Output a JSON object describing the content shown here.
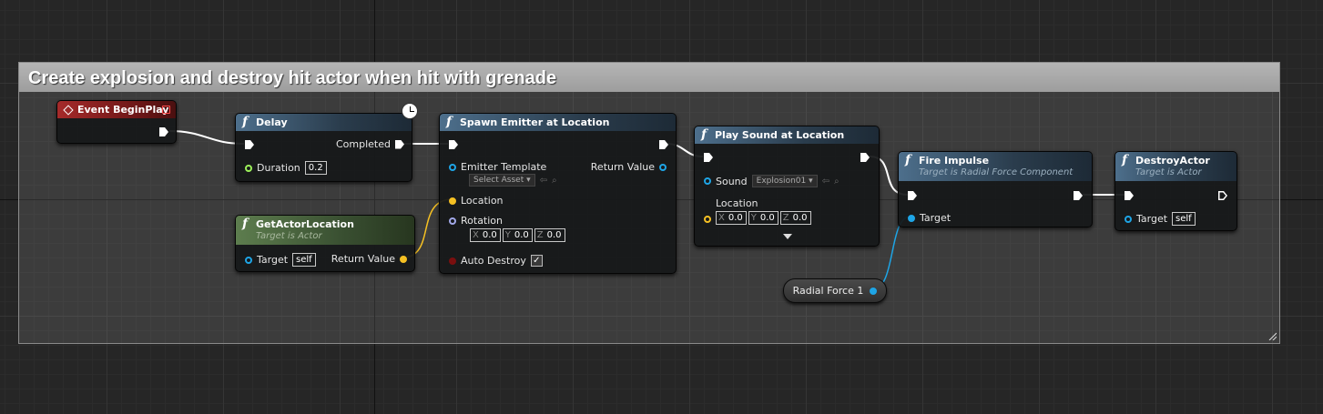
{
  "comment": {
    "title": "Create explosion and destroy hit actor when hit with grenade"
  },
  "nodes": {
    "event_begin_play": {
      "title": "Event BeginPlay"
    },
    "delay": {
      "title": "Delay",
      "out_completed": "Completed",
      "duration_label": "Duration",
      "duration_value": "0.2"
    },
    "get_actor_location": {
      "title": "GetActorLocation",
      "subtitle": "Target is Actor",
      "target_label": "Target",
      "target_value": "self",
      "return_label": "Return Value"
    },
    "spawn_emitter": {
      "title": "Spawn Emitter at Location",
      "emitter_label": "Emitter Template",
      "emitter_value": "Select Asset",
      "return_label": "Return Value",
      "location_label": "Location",
      "rotation_label": "Rotation",
      "rot_x": "0.0",
      "rot_y": "0.0",
      "rot_z": "0.0",
      "auto_destroy_label": "Auto Destroy",
      "auto_destroy_checked": true
    },
    "play_sound": {
      "title": "Play Sound at Location",
      "sound_label": "Sound",
      "sound_value": "Explosion01",
      "location_label": "Location",
      "loc_x": "0.0",
      "loc_y": "0.0",
      "loc_z": "0.0"
    },
    "fire_impulse": {
      "title": "Fire Impulse",
      "subtitle": "Target is Radial Force Component",
      "target_label": "Target"
    },
    "destroy_actor": {
      "title": "DestroyActor",
      "subtitle": "Target is Actor",
      "target_label": "Target",
      "target_value": "self"
    },
    "radial_force": {
      "label": "Radial Force 1"
    }
  },
  "axis_labels": {
    "x": "X",
    "y": "Y",
    "z": "Z"
  },
  "colors": {
    "exec_wire": "#ffffff",
    "object_pin": "#1ea5e6",
    "vector_pin": "#f5c023",
    "float_pin": "#9cf05a",
    "rotator_pin": "#a2a8e8",
    "bool_pin": "#7a0f0f",
    "function_header": "#4d6f8c",
    "pure_header": "#5d7d4e",
    "event_header": "#a52a2a"
  }
}
